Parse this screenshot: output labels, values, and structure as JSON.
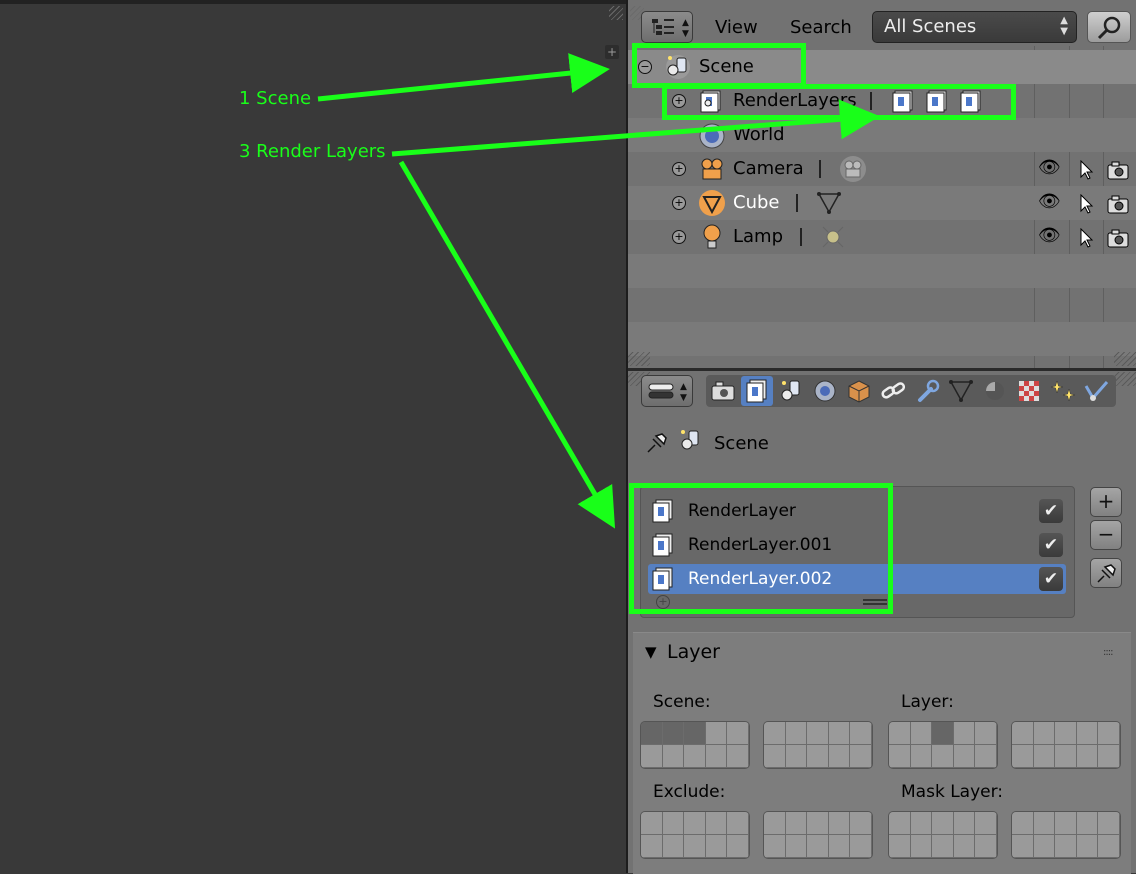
{
  "outliner": {
    "menu": {
      "view": "View",
      "search": "Search"
    },
    "display_mode": "All Scenes",
    "rows": [
      {
        "label": "Scene"
      },
      {
        "label": "RenderLayers"
      },
      {
        "label": "World"
      },
      {
        "label": "Camera"
      },
      {
        "label": "Cube"
      },
      {
        "label": "Lamp"
      }
    ]
  },
  "properties": {
    "breadcrumb": "Scene",
    "render_layers": [
      {
        "label": "RenderLayer",
        "enabled": true
      },
      {
        "label": "RenderLayer.001",
        "enabled": true
      },
      {
        "label": "RenderLayer.002",
        "enabled": true
      }
    ],
    "panel_title": "Layer",
    "labels": {
      "scene": "Scene:",
      "layer": "Layer:",
      "exclude": "Exclude:",
      "mask": "Mask Layer:"
    }
  },
  "annotations": {
    "one_scene": "1 Scene",
    "three_render_layers": "3 Render Layers"
  },
  "colors": {
    "annotation": "#19ff19",
    "selection": "#5680c2"
  }
}
